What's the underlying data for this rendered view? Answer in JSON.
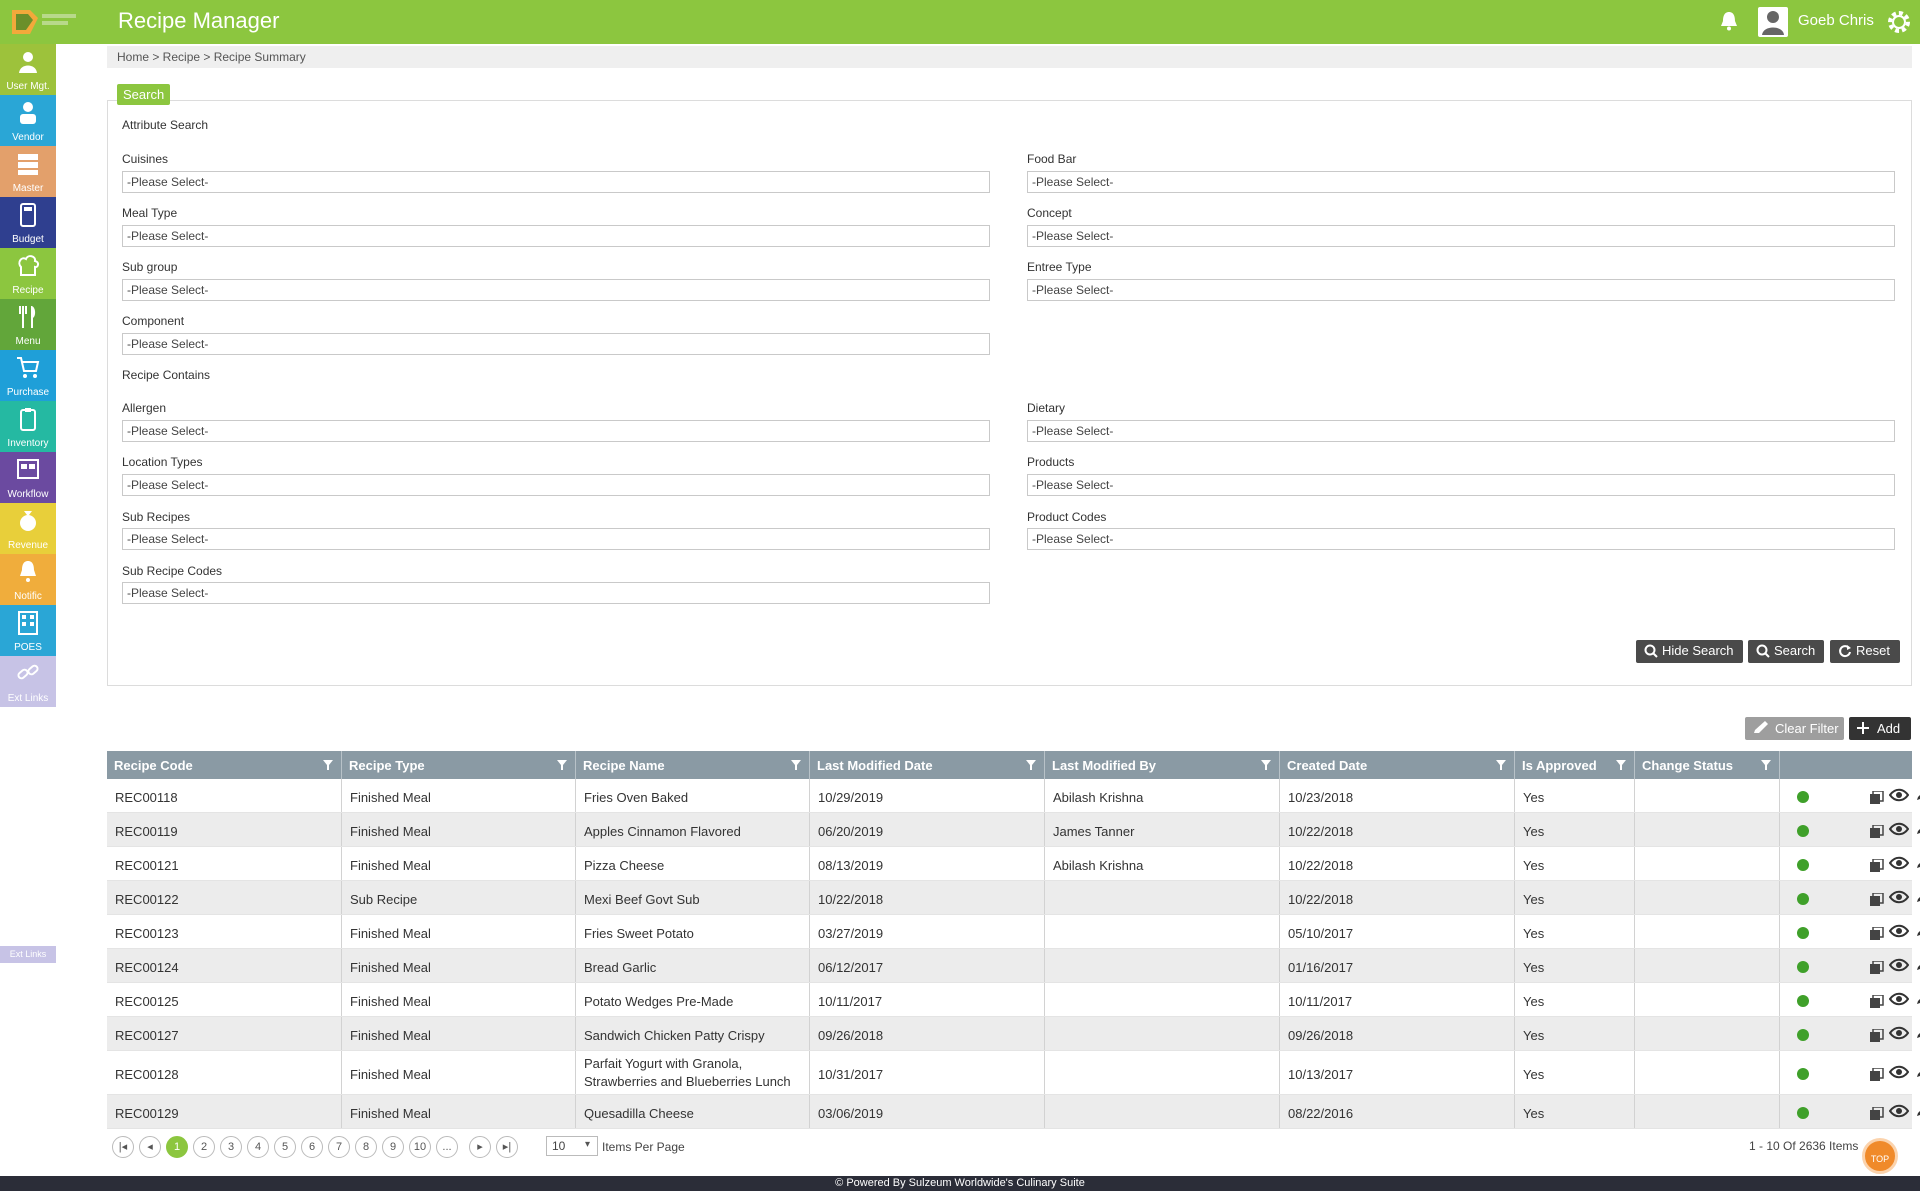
{
  "app": {
    "title": "Recipe Manager",
    "user_name": "Goeb Chris"
  },
  "sidebar": {
    "items": [
      {
        "label": "User Mgt.",
        "color": "#9dc23b"
      },
      {
        "label": "Vendor",
        "color": "#2aa6d6"
      },
      {
        "label": "Master",
        "color": "#e3a06b"
      },
      {
        "label": "Budget",
        "color": "#2f3f8f"
      },
      {
        "label": "Recipe",
        "color": "#8cc63f"
      },
      {
        "label": "Menu",
        "color": "#62a63a"
      },
      {
        "label": "Purchase",
        "color": "#1f9fd8"
      },
      {
        "label": "Inventory",
        "color": "#25b9a2"
      },
      {
        "label": "Workflow",
        "color": "#6b4aa0"
      },
      {
        "label": "Revenue",
        "color": "#e8cf3a"
      },
      {
        "label": "Notific",
        "color": "#f0ad3c"
      },
      {
        "label": "POES",
        "color": "#2aa6d6"
      },
      {
        "label": "Ext Links",
        "color": "#c7c3e6"
      }
    ],
    "ghost_label": "Ext Links"
  },
  "breadcrumb": "Home > Recipe > Recipe Summary",
  "search": {
    "tab_label": "Search",
    "attribute_heading": "Attribute Search",
    "contains_heading": "Recipe Contains",
    "placeholder": "-Please Select-",
    "fields": {
      "cuisines": "Cuisines",
      "food_bar": "Food Bar",
      "meal_type": "Meal Type",
      "concept": "Concept",
      "sub_group": "Sub group",
      "entree_type": "Entree Type",
      "component": "Component",
      "allergen": "Allergen",
      "dietary": "Dietary",
      "location_types": "Location Types",
      "products": "Products",
      "sub_recipes": "Sub Recipes",
      "product_codes": "Product Codes",
      "sub_recipe_codes": "Sub Recipe Codes"
    },
    "buttons": {
      "hide": "Hide Search",
      "search": "Search",
      "reset": "Reset"
    }
  },
  "grid": {
    "clear_filter": "Clear Filter",
    "add": "Add",
    "columns": [
      "Recipe Code",
      "Recipe Type",
      "Recipe Name",
      "Last Modified Date",
      "Last Modified By",
      "Created Date",
      "Is Approved",
      "Change Status"
    ],
    "rows": [
      {
        "code": "REC00118",
        "type": "Finished Meal",
        "name": "Fries Oven Baked",
        "modified": "10/29/2019",
        "modified_by": "Abilash Krishna",
        "created": "10/23/2018",
        "approved": "Yes"
      },
      {
        "code": "REC00119",
        "type": "Finished Meal",
        "name": "Apples Cinnamon Flavored",
        "modified": "06/20/2019",
        "modified_by": "James Tanner",
        "created": "10/22/2018",
        "approved": "Yes"
      },
      {
        "code": "REC00121",
        "type": "Finished Meal",
        "name": "Pizza Cheese",
        "modified": "08/13/2019",
        "modified_by": "Abilash Krishna",
        "created": "10/22/2018",
        "approved": "Yes"
      },
      {
        "code": "REC00122",
        "type": "Sub Recipe",
        "name": "Mexi Beef Govt Sub",
        "modified": "10/22/2018",
        "modified_by": "",
        "created": "10/22/2018",
        "approved": "Yes"
      },
      {
        "code": "REC00123",
        "type": "Finished Meal",
        "name": "Fries Sweet Potato",
        "modified": "03/27/2019",
        "modified_by": "",
        "created": "05/10/2017",
        "approved": "Yes"
      },
      {
        "code": "REC00124",
        "type": "Finished Meal",
        "name": "Bread Garlic",
        "modified": "06/12/2017",
        "modified_by": "",
        "created": "01/16/2017",
        "approved": "Yes"
      },
      {
        "code": "REC00125",
        "type": "Finished Meal",
        "name": "Potato Wedges Pre-Made",
        "modified": "10/11/2017",
        "modified_by": "",
        "created": "10/11/2017",
        "approved": "Yes"
      },
      {
        "code": "REC00127",
        "type": "Finished Meal",
        "name": "Sandwich Chicken Patty Crispy",
        "modified": "09/26/2018",
        "modified_by": "",
        "created": "09/26/2018",
        "approved": "Yes"
      },
      {
        "code": "REC00128",
        "type": "Finished Meal",
        "name": "Parfait Yogurt with Granola, Strawberries and Blueberries Lunch",
        "modified": "10/31/2017",
        "modified_by": "",
        "created": "10/13/2017",
        "approved": "Yes"
      },
      {
        "code": "REC00129",
        "type": "Finished Meal",
        "name": "Quesadilla Cheese",
        "modified": "03/06/2019",
        "modified_by": "",
        "created": "08/22/2016",
        "approved": "Yes"
      }
    ]
  },
  "pager": {
    "pages": [
      "1",
      "2",
      "3",
      "4",
      "5",
      "6",
      "7",
      "8",
      "9",
      "10",
      "..."
    ],
    "current": "1",
    "per_page": "10",
    "per_page_label": "Items Per Page",
    "summary": "1 - 10 Of 2636 Items"
  },
  "top_button": "TOP",
  "footer": "© Powered By Sulzeum Worldwide's Culinary Suite"
}
